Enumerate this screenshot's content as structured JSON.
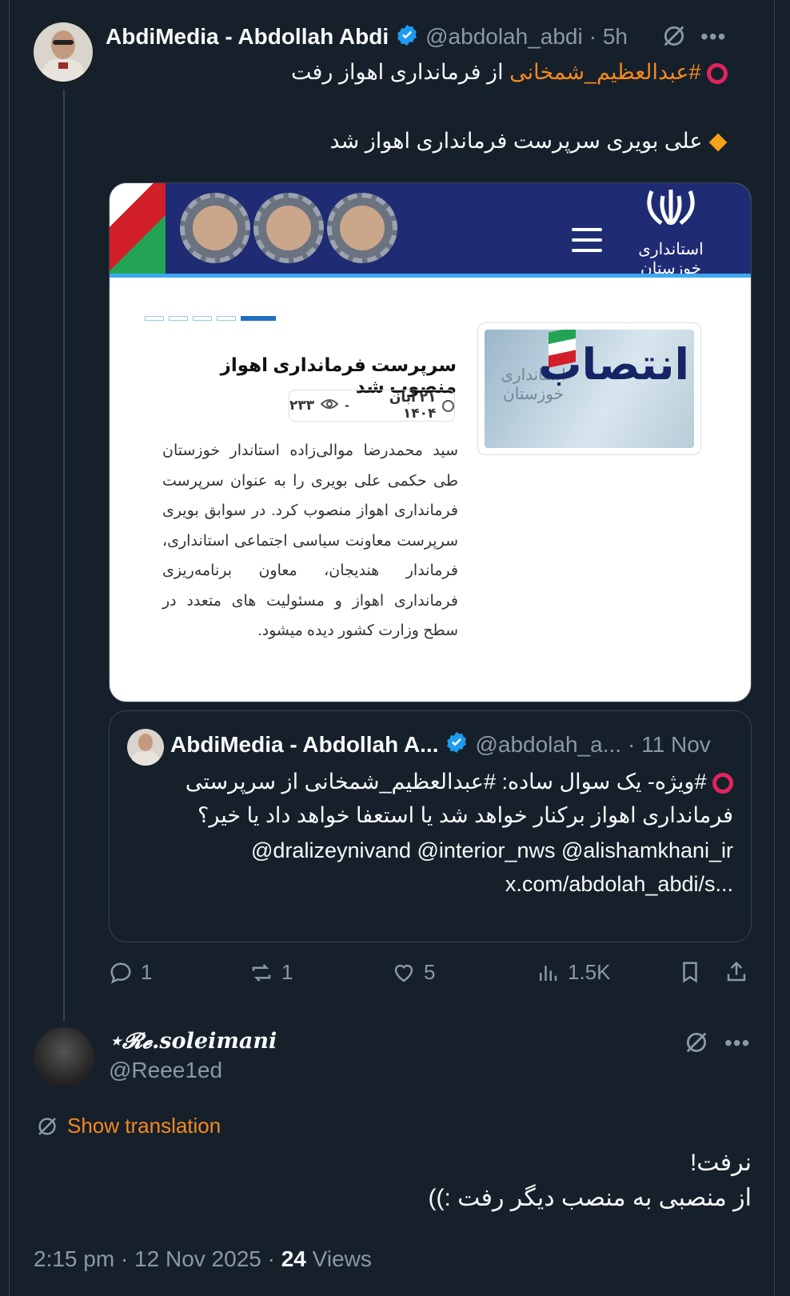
{
  "main_tweet": {
    "author_name": "AbdiMedia - Abdollah Abdi",
    "author_handle": "@abdolah_abdi",
    "time": "· 5h",
    "line1_hashtag": "#عبدالعظیم_شمخانی",
    "line1_rest": " از فرمانداری اهواز رفت",
    "line2": "علی بویری سرپرست فرمانداری اهواز شد"
  },
  "card": {
    "site_logo_text": "استانداری خوزستان",
    "image_word": "انتصاب",
    "image_overlay": "استانداری خوزستان",
    "article_title": "سرپرست فرمانداری اهواز منصوب شد",
    "article_date": "۲۱ آبان ۱۴۰۴",
    "article_views": "۲۳۳",
    "article_body": "سید محمدرضا موالی‌زاده استاندار خوزستان طی حکمی علی بویری را به عنوان سرپرست فرمانداری اهواز منصوب کرد. در سوابق بویری سرپرست معاونت سیاسی اجتماعی استانداری، فرماندار هندیجان، معاون برنامه‌ریزی فرمانداری اهواز و مسئولیت های متعدد در سطح وزارت کشور دیده میشود."
  },
  "quoted_tweet": {
    "author_name": "AbdiMedia - Abdollah A...",
    "author_handle": "@abdolah_a...",
    "time": "· 11 Nov",
    "text_line1": "#ویژه- یک سوال ساده: #عبدالعظیم_شمخانی از سرپرستی",
    "text_line2": "فرمانداری اهواز برکنار خواهد شد یا استعفا خواهد داد یا خیر؟",
    "text_line3": "@dralizeynivand @interior_nws @alishamkhani_ir",
    "text_line4": "x.com/abdolah_abdi/s..."
  },
  "actions": {
    "replies": "1",
    "reposts": "1",
    "likes": "5",
    "views": "1.5K"
  },
  "reply": {
    "author_name": "⋆𝓡𝓮.soleimani",
    "author_handle": "@Reee1ed",
    "show_translation": "Show translation",
    "line1": "نرفت!",
    "line2": "از منصبی به منصب دیگر رفت :))",
    "timestamp": "2:15 pm · 12 Nov 2025 ·",
    "views_count": "24",
    "views_label": "Views"
  },
  "colors": {
    "background": "#15202b",
    "accent_orange": "#f6881f",
    "verified_blue": "#1d9bf0",
    "muted": "#8b98a5"
  }
}
